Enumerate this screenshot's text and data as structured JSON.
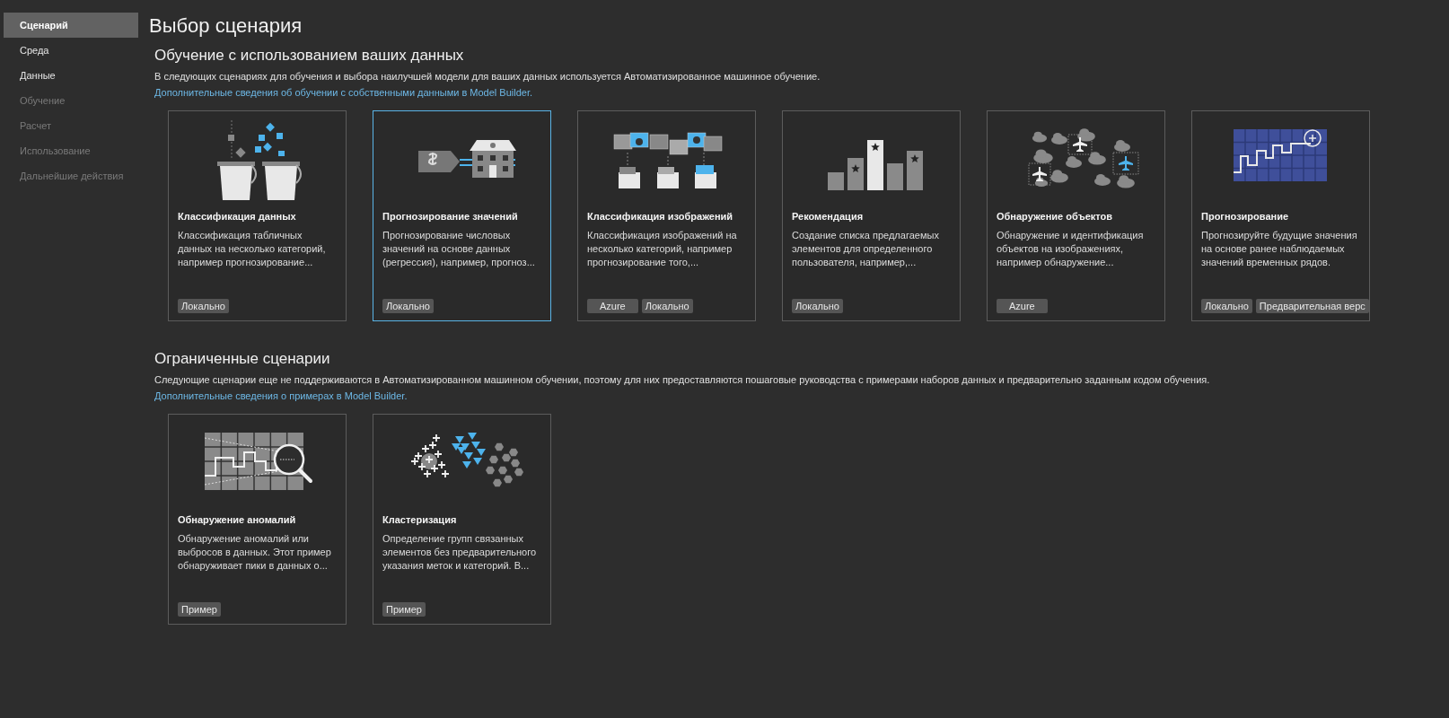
{
  "sidebar": {
    "items": [
      {
        "label": "Сценарий",
        "selected": true,
        "disabled": false
      },
      {
        "label": "Среда",
        "selected": false,
        "disabled": false
      },
      {
        "label": "Данные",
        "selected": false,
        "disabled": false
      },
      {
        "label": "Обучение",
        "selected": false,
        "disabled": true
      },
      {
        "label": "Расчет",
        "selected": false,
        "disabled": true
      },
      {
        "label": "Использование",
        "selected": false,
        "disabled": true
      },
      {
        "label": "Дальнейшие действия",
        "selected": false,
        "disabled": true
      }
    ]
  },
  "title": "Выбор сценария",
  "sections": [
    {
      "heading": "Обучение с использованием ваших данных",
      "description": "В следующих сценариях для обучения и выбора наилучшей модели для ваших данных используется Автоматизированное машинное обучение.",
      "link": "Дополнительные сведения об обучении с собственными данными в Model Builder.",
      "cards": [
        {
          "kind": "buckets",
          "title": "Классификация данных",
          "description": "Классификация табличных данных на несколько категорий, например прогнозирование...",
          "tags": [
            "Локально"
          ],
          "selected": false
        },
        {
          "kind": "house",
          "title": "Прогнозирование значений",
          "description": "Прогнозирование числовых значений на основе данных (регрессия), например, прогноз...",
          "tags": [
            "Локально"
          ],
          "selected": true
        },
        {
          "kind": "images",
          "title": "Классификация изображений",
          "description": "Классификация изображений на несколько категорий, например прогнозирование того,...",
          "tags": [
            "Azure",
            "Локально"
          ],
          "selected": false
        },
        {
          "kind": "bars",
          "title": "Рекомендация",
          "description": "Создание списка предлагаемых элементов для определенного пользователя, например,...",
          "tags": [
            "Локально"
          ],
          "selected": false
        },
        {
          "kind": "planes",
          "title": "Обнаружение объектов",
          "description": "Обнаружение и идентификация объектов на изображениях, например обнаружение...",
          "tags": [
            "Azure"
          ],
          "selected": false
        },
        {
          "kind": "timeseries",
          "title": "Прогнозирование",
          "description": "Прогнозируйте будущие значения на основе ранее наблюдаемых значений временных рядов.",
          "tags": [
            "Локально",
            "Предварительная верс"
          ],
          "selected": false
        }
      ]
    },
    {
      "heading": "Ограниченные сценарии",
      "description": "Следующие сценарии еще не поддерживаются в Автоматизированном машинном обучении, поэтому для них предоставляются пошаговые руководства с примерами наборов данных и предварительно заданным кодом обучения.",
      "link": "Дополнительные сведения о примерах в Model Builder.",
      "cards": [
        {
          "kind": "anomaly",
          "title": "Обнаружение аномалий",
          "description": "Обнаружение аномалий или выбросов в данных. Этот пример обнаруживает пики в данных о...",
          "tags": [
            "Пример"
          ],
          "selected": false
        },
        {
          "kind": "clusters",
          "title": "Кластеризация",
          "description": "Определение групп связанных элементов без предварительного указания меток и категорий. В...",
          "tags": [
            "Пример"
          ],
          "selected": false
        }
      ]
    }
  ]
}
